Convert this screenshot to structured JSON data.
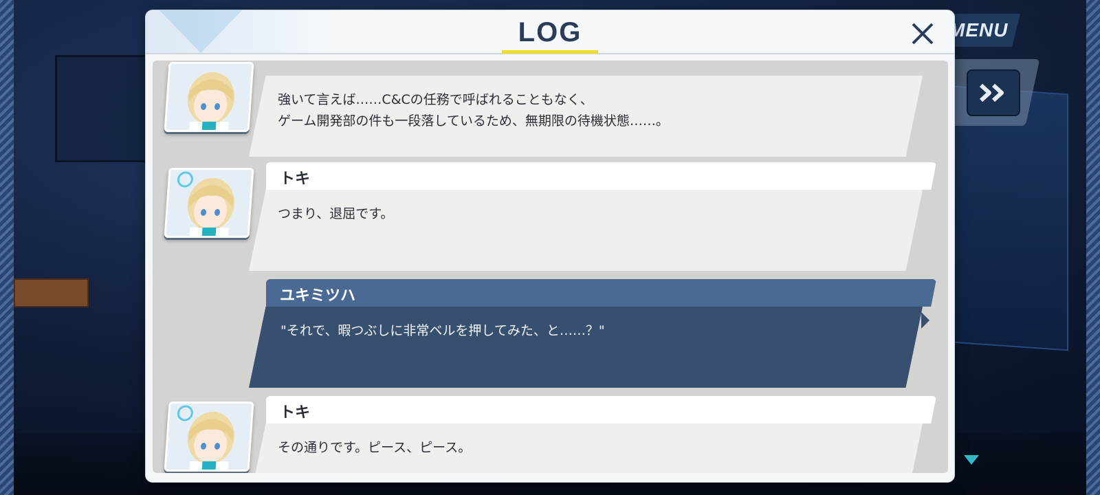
{
  "hud": {
    "menu_label": "MENU",
    "fast_forward_icon": "double-chevron-right-icon"
  },
  "log": {
    "title": "LOG",
    "close_icon": "close-icon",
    "entries": [
      {
        "speaker": "",
        "text": "強いて言えば……C&Cの任務で呼ばれることもなく、\nゲーム開発部の件も一段落しているため、無期限の待機状態……。",
        "is_player": false
      },
      {
        "speaker": "トキ",
        "text": "つまり、退屈です。",
        "is_player": false
      },
      {
        "speaker": "ユキミツハ",
        "text": "\"それで、暇つぶしに非常ベルを押してみた、と……？\"",
        "is_player": true
      },
      {
        "speaker": "トキ",
        "text": "その通りです。ピース、ピース。",
        "is_player": false
      }
    ]
  },
  "colors": {
    "accent_yellow": "#f3da2a",
    "player_bubble": "#37506f",
    "player_name_bar": "#4b6a93",
    "npc_bubble": "#efefed"
  }
}
